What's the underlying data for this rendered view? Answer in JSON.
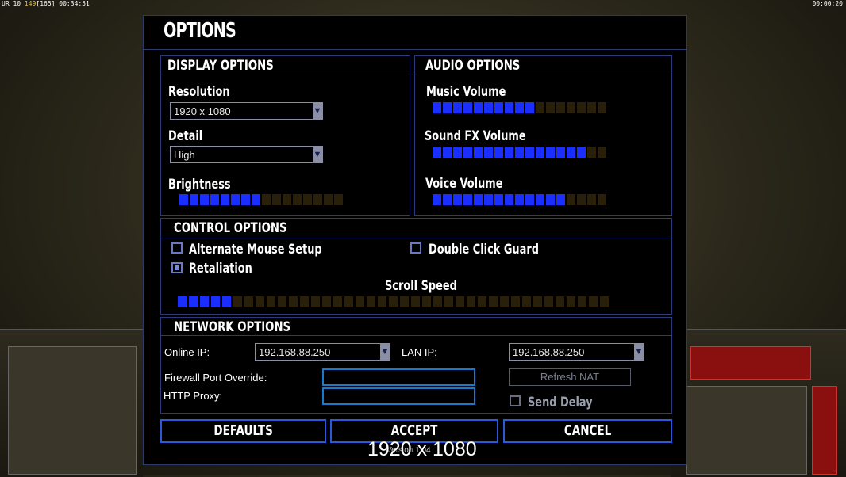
{
  "hud": {
    "left_prefix": "UR 10",
    "left_value": "149",
    "left_bracket": "[165]",
    "left_time": "00:34:51",
    "right_time": "00:00:20"
  },
  "dialog": {
    "title": "OPTIONS"
  },
  "display": {
    "header": "DISPLAY OPTIONS",
    "resolution_label": "Resolution",
    "resolution_value": "1920 x 1080",
    "detail_label": "Detail",
    "detail_value": "High",
    "brightness_label": "Brightness",
    "brightness_level": 0.5,
    "brightness_segments": 16,
    "brightness_on": 8
  },
  "audio": {
    "header": "AUDIO OPTIONS",
    "music_label": "Music Volume",
    "music_segments": 17,
    "music_on": 10,
    "sfx_label": "Sound FX Volume",
    "sfx_segments": 17,
    "sfx_on": 15,
    "voice_label": "Voice Volume",
    "voice_segments": 17,
    "voice_on": 13
  },
  "control": {
    "header": "CONTROL OPTIONS",
    "alt_mouse_label": "Alternate Mouse Setup",
    "alt_mouse_checked": false,
    "double_click_label": "Double Click Guard",
    "double_click_checked": false,
    "retaliation_label": "Retaliation",
    "retaliation_checked": true,
    "scroll_label": "Scroll Speed",
    "scroll_segments": 39,
    "scroll_on": 5
  },
  "network": {
    "header": "NETWORK OPTIONS",
    "online_ip_label": "Online IP:",
    "online_ip_value": "192.168.88.250",
    "lan_ip_label": "LAN IP:",
    "lan_ip_value": "192.168.88.250",
    "firewall_label": "Firewall Port Override:",
    "firewall_value": "",
    "proxy_label": "HTTP Proxy:",
    "proxy_value": "",
    "refresh_nat_label": "Refresh NAT",
    "send_delay_label": "Send Delay",
    "send_delay_checked": false
  },
  "buttons": {
    "defaults": "DEFAULTS",
    "accept": "ACCEPT",
    "cancel": "CANCEL"
  },
  "footer": {
    "version": "Version 1.04",
    "resolution_overlay": "1920 x 1080"
  },
  "colors": {
    "slider_on": "#1a2eff",
    "slider_off": "#2a1f08",
    "border": "#2a3a7a"
  }
}
